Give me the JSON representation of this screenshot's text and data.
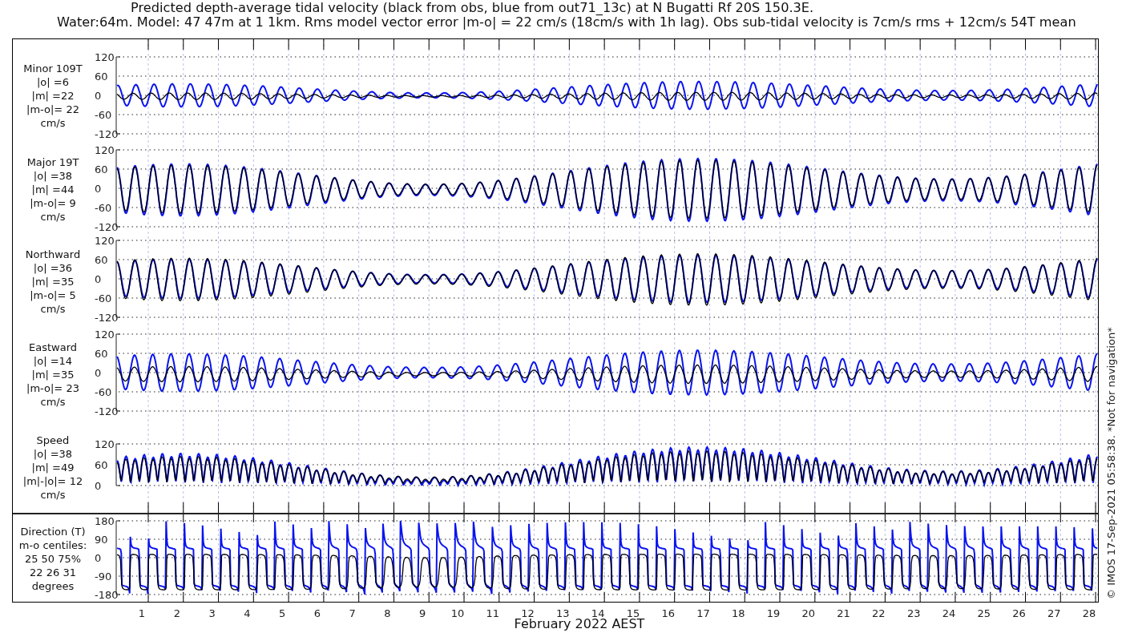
{
  "title": "Predicted depth-average tidal velocity (black from obs, blue from out71_13c) at N Bugatti Rf 20S 150.3E.",
  "subtitle": "Water:64m. Model: 47 47m at 1 1km. Rms model vector error |m-o| = 22 cm/s (18cm/s with 1h lag). Obs sub-tidal velocity is 7cm/s rms + 12cm/s 54T mean",
  "panels": [
    {
      "label_lines": [
        "Minor 109T",
        "|o| =6",
        "|m| =22",
        "|m-o|= 22",
        "cm/s"
      ],
      "yticks": [
        "120",
        "60",
        "0",
        "-60",
        "-120"
      ]
    },
    {
      "label_lines": [
        "Major 19T",
        "|o| =38",
        "|m| =44",
        "|m-o|= 9",
        "cm/s"
      ],
      "yticks": [
        "120",
        "60",
        "0",
        "-60",
        "-120"
      ]
    },
    {
      "label_lines": [
        "Northward",
        "|o| =36",
        "|m| =35",
        "|m-o|= 5",
        "cm/s"
      ],
      "yticks": [
        "120",
        "60",
        "0",
        "-60",
        "-120"
      ]
    },
    {
      "label_lines": [
        "Eastward",
        "|o| =14",
        "|m| =35",
        "|m-o|= 23",
        "cm/s"
      ],
      "yticks": [
        "120",
        "60",
        "0",
        "-60",
        "-120"
      ]
    },
    {
      "label_lines": [
        "Speed",
        "|o| =38",
        "|m| =49",
        "|m|-|o|= 12",
        "cm/s"
      ],
      "yticks": [
        "120",
        "60",
        "0"
      ]
    }
  ],
  "direction_panel": {
    "label_lines": [
      "Direction (T)",
      "m-o centiles:",
      "25  50  75%",
      "22  26  31",
      "degrees"
    ],
    "yticks": [
      "180",
      "90",
      "0",
      "-90",
      "-180"
    ]
  },
  "xticks": [
    "1",
    "2",
    "3",
    "4",
    "5",
    "6",
    "7",
    "8",
    "9",
    "10",
    "11",
    "12",
    "13",
    "14",
    "15",
    "16",
    "17",
    "18",
    "19",
    "20",
    "21",
    "22",
    "23",
    "24",
    "25",
    "26",
    "27",
    "28"
  ],
  "xlabel": "February 2022 AEST",
  "copyright": "© IMOS 17-Sep-2021 05:58:38. *Not for navigation*"
}
